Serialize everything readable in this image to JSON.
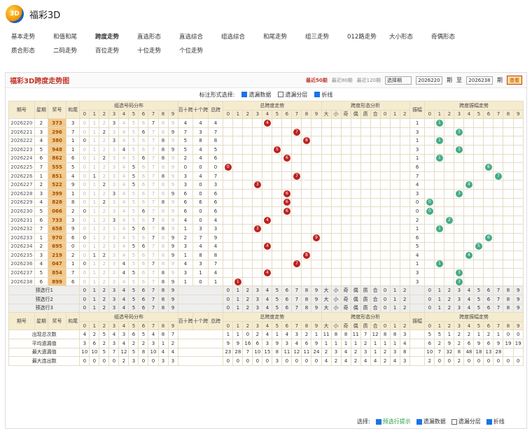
{
  "app": {
    "title": "福彩3D"
  },
  "nav": [
    "基本走势",
    "和值和尾",
    "跨度走势",
    "直选形态",
    "直选综合",
    "组选综合",
    "和尾走势",
    "组三走势",
    "012路走势",
    "大小形态",
    "奇偶形态",
    "质合形态",
    "二码走势",
    "百位走势",
    "十位走势",
    "个位走势"
  ],
  "nav_active": 2,
  "panel": {
    "title": "福彩3D跨度走势图",
    "ranges": [
      "最近50期",
      "最近80期",
      "最近120期"
    ],
    "select": "选择期",
    "from": "2026220",
    "to_label": "至",
    "period_unit": "期",
    "to": "2026238",
    "query": "查看"
  },
  "opts_top": {
    "label": "标注形式选择:",
    "a": "遗漏数据",
    "b": "遗漏分层",
    "c": "折线"
  },
  "headers": {
    "period": "期号",
    "week": "星期",
    "num": "奖号",
    "sum": "和尾",
    "group": "组选号码分布",
    "bai": "百十跨",
    "shi": "十个跨",
    "zong": "总跨",
    "span": "总跨度走势",
    "form": "跨度形态分析",
    "zhen": "振幅",
    "zhentrend": "跨度振幅走势",
    "digits": [
      "0",
      "1",
      "2",
      "3",
      "4",
      "5",
      "6",
      "7",
      "8",
      "9"
    ],
    "form_cols": [
      "大",
      "小",
      "奇",
      "偶",
      "质",
      "合",
      "0",
      "1",
      "2"
    ]
  },
  "rows": [
    {
      "p": "2026220",
      "w": "2",
      "n": "373",
      "s": "3",
      "b": "4",
      "t": "4",
      "z": "4",
      "zh": "1"
    },
    {
      "p": "2026221",
      "w": "3",
      "n": "296",
      "s": "7",
      "b": "7",
      "t": "3",
      "z": "7",
      "zh": "3"
    },
    {
      "p": "2026222",
      "w": "4",
      "n": "380",
      "s": "1",
      "b": "5",
      "t": "8",
      "z": "8",
      "zh": "1"
    },
    {
      "p": "2026223",
      "w": "5",
      "n": "948",
      "s": "1",
      "b": "5",
      "t": "4",
      "z": "5",
      "zh": "3"
    },
    {
      "p": "2026224",
      "w": "6",
      "n": "862",
      "s": "6",
      "b": "2",
      "t": "4",
      "z": "6",
      "zh": "1"
    },
    {
      "p": "2026225",
      "w": "7",
      "n": "555",
      "s": "5",
      "b": "0",
      "t": "0",
      "z": "0",
      "zh": "6"
    },
    {
      "p": "2026226",
      "w": "1",
      "n": "851",
      "s": "4",
      "b": "3",
      "t": "4",
      "z": "7",
      "zh": "7"
    },
    {
      "p": "2026227",
      "w": "2",
      "n": "522",
      "s": "9",
      "b": "3",
      "t": "0",
      "z": "3",
      "zh": "4"
    },
    {
      "p": "2026228",
      "w": "3",
      "n": "399",
      "s": "1",
      "b": "6",
      "t": "0",
      "z": "6",
      "zh": "3"
    },
    {
      "p": "2026229",
      "w": "4",
      "n": "828",
      "s": "8",
      "b": "6",
      "t": "6",
      "z": "6",
      "zh": "0"
    },
    {
      "p": "2026230",
      "w": "5",
      "n": "066",
      "s": "2",
      "b": "6",
      "t": "0",
      "z": "6",
      "zh": "0"
    },
    {
      "p": "2026231",
      "w": "6",
      "n": "733",
      "s": "3",
      "b": "4",
      "t": "0",
      "z": "4",
      "zh": "2"
    },
    {
      "p": "2026232",
      "w": "7",
      "n": "658",
      "s": "9",
      "b": "1",
      "t": "3",
      "z": "3",
      "zh": "1"
    },
    {
      "p": "2026233",
      "w": "1",
      "n": "970",
      "s": "6",
      "b": "2",
      "t": "7",
      "z": "9",
      "zh": "6"
    },
    {
      "p": "2026234",
      "w": "2",
      "n": "695",
      "s": "0",
      "b": "3",
      "t": "4",
      "z": "4",
      "zh": "5"
    },
    {
      "p": "2026235",
      "w": "3",
      "n": "219",
      "s": "2",
      "b": "1",
      "t": "8",
      "z": "8",
      "zh": "4"
    },
    {
      "p": "2026236",
      "w": "4",
      "n": "047",
      "s": "1",
      "b": "4",
      "t": "3",
      "z": "7",
      "zh": "1"
    },
    {
      "p": "2026237",
      "w": "5",
      "n": "854",
      "s": "7",
      "b": "3",
      "t": "1",
      "z": "4",
      "zh": "3"
    },
    {
      "p": "2026238",
      "w": "6",
      "n": "899",
      "s": "6",
      "b": "1",
      "t": "0",
      "z": "1",
      "zh": "3"
    }
  ],
  "pred": [
    "预选行1",
    "预选行2",
    "预选行3"
  ],
  "stats": [
    {
      "label": "出现总次数",
      "g": [
        "4",
        "2",
        "5",
        "4",
        "3",
        "6",
        "5",
        "4",
        "8",
        "7"
      ],
      "z": [
        "1",
        "1",
        "0",
        "2",
        "4",
        "1",
        "4",
        "3",
        "2",
        "1"
      ],
      "f": [
        "11",
        "8",
        "8",
        "11",
        "7",
        "12",
        "8",
        "8",
        "3"
      ],
      "v": [
        "5",
        "5",
        "1",
        "2",
        "2",
        "1",
        "2",
        "1",
        "0",
        "0"
      ]
    },
    {
      "label": "平均遗漏值",
      "g": [
        "3",
        "6",
        "2",
        "3",
        "4",
        "2",
        "2",
        "3",
        "1",
        "2"
      ],
      "z": [
        "9",
        "9",
        "16",
        "6",
        "3",
        "9",
        "3",
        "4",
        "6",
        "9"
      ],
      "f": [
        "1",
        "1",
        "1",
        "1",
        "2",
        "1",
        "1",
        "1",
        "4"
      ],
      "v": [
        "6",
        "2",
        "9",
        "2",
        "6",
        "9",
        "6",
        "9",
        "19",
        "19"
      ]
    },
    {
      "label": "最大遗漏值",
      "g": [
        "10",
        "10",
        "5",
        "7",
        "12",
        "5",
        "8",
        "10",
        "4",
        "4"
      ],
      "z": [
        "23",
        "28",
        "7",
        "10",
        "15",
        "8",
        "11",
        "12",
        "11",
        "24"
      ],
      "f": [
        "2",
        "3",
        "4",
        "2",
        "3",
        "1",
        "2",
        "3",
        "8"
      ],
      "v": [
        "10",
        "7",
        "32",
        "8",
        "48",
        "18",
        "13",
        "28",
        "",
        ""
      ]
    },
    {
      "label": "最大连出数",
      "g": [
        "0",
        "0",
        "0",
        "0",
        "2",
        "3",
        "0",
        "0",
        "3",
        "3"
      ],
      "z": [
        "0",
        "0",
        "0",
        "0",
        "0",
        "3",
        "0",
        "0",
        "0",
        "0"
      ],
      "f": [
        "4",
        "2",
        "4",
        "2",
        "4",
        "4",
        "2",
        "4",
        "3"
      ],
      "v": [
        "2",
        "0",
        "0",
        "2",
        "0",
        "0",
        "0",
        "0",
        "0",
        "0"
      ]
    }
  ],
  "opts_bottom": {
    "label": "选择:",
    "a": "预选行提示",
    "b": "遗漏数据",
    "c": "遗漏分层",
    "d": "折线"
  },
  "colors": {
    "accent": "#c0392b",
    "header_bg": "#f5ecd0",
    "highlight": "#f3c98a"
  }
}
